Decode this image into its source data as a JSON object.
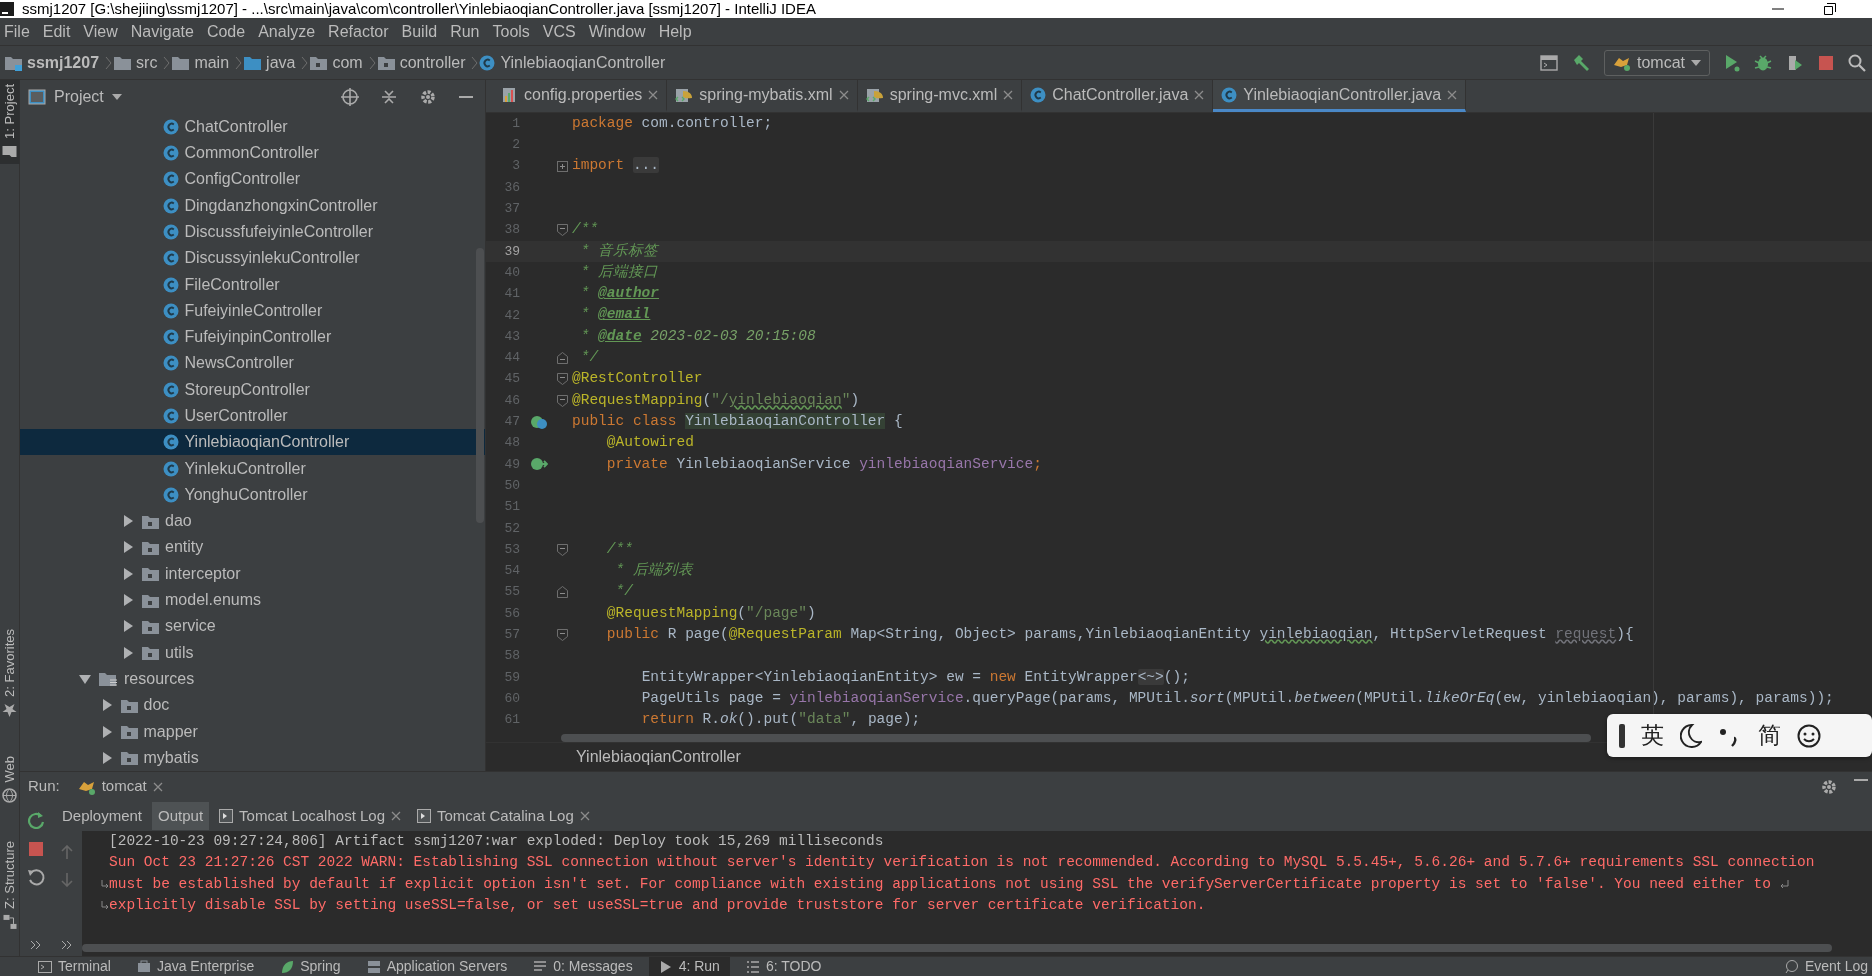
{
  "window": {
    "title": "ssmj1207 [G:\\shejiing\\ssmj1207] - ...\\src\\main\\java\\com\\controller\\YinlebiaoqianController.java [ssmj1207] - IntelliJ IDEA"
  },
  "menu": [
    "File",
    "Edit",
    "View",
    "Navigate",
    "Code",
    "Analyze",
    "Refactor",
    "Build",
    "Run",
    "Tools",
    "VCS",
    "Window",
    "Help"
  ],
  "breadcrumb": [
    {
      "label": "ssmj1207",
      "kind": "module"
    },
    {
      "label": "src",
      "kind": "folder"
    },
    {
      "label": "main",
      "kind": "folder"
    },
    {
      "label": "java",
      "kind": "source"
    },
    {
      "label": "com",
      "kind": "package"
    },
    {
      "label": "controller",
      "kind": "package"
    },
    {
      "label": "YinlebiaoqianController",
      "kind": "class"
    }
  ],
  "run_config": {
    "label": "tomcat"
  },
  "side_tabs": [
    {
      "label": "1: Project",
      "kind": "project",
      "selected": true
    },
    {
      "label": "2: Favorites",
      "kind": "favorites",
      "selected": false
    },
    {
      "label": "Web",
      "kind": "web",
      "selected": false
    },
    {
      "label": "Z: Structure",
      "kind": "structure",
      "selected": false
    }
  ],
  "project": {
    "title": "Project",
    "tree": [
      {
        "children": [
          {
            "children": [
              {
                "children": [
                  {
                    "label": "ChatController",
                    "kind": "class",
                    "selected": false
                  },
                  {
                    "label": "CommonController",
                    "kind": "class",
                    "selected": false
                  },
                  {
                    "label": "ConfigController",
                    "kind": "class",
                    "selected": false
                  },
                  {
                    "label": "DingdanzhongxinController",
                    "kind": "class",
                    "selected": false
                  },
                  {
                    "label": "DiscussfufeiyinleController",
                    "kind": "class",
                    "selected": false
                  },
                  {
                    "label": "DiscussyinlekuController",
                    "kind": "class",
                    "selected": false
                  },
                  {
                    "label": "FileController",
                    "kind": "class",
                    "selected": false
                  },
                  {
                    "label": "FufeiyinleController",
                    "kind": "class",
                    "selected": false
                  },
                  {
                    "label": "FufeiyinpinController",
                    "kind": "class",
                    "selected": false
                  },
                  {
                    "label": "NewsController",
                    "kind": "class",
                    "selected": false
                  },
                  {
                    "label": "StoreupController",
                    "kind": "class",
                    "selected": false
                  },
                  {
                    "label": "UserController",
                    "kind": "class",
                    "selected": false
                  },
                  {
                    "label": "YinlebiaoqianController",
                    "kind": "class",
                    "selected": true
                  },
                  {
                    "label": "YinlekuController",
                    "kind": "class",
                    "selected": false
                  },
                  {
                    "label": "YonghuController",
                    "kind": "class",
                    "selected": false
                  }
                ]
              },
              {
                "label": "dao",
                "kind": "package",
                "selected": false,
                "expanded": false
              },
              {
                "label": "entity",
                "kind": "package",
                "selected": false,
                "expanded": false
              },
              {
                "label": "interceptor",
                "kind": "package",
                "selected": false,
                "expanded": false
              },
              {
                "label": "model.enums",
                "kind": "package",
                "selected": false,
                "expanded": false
              },
              {
                "label": "service",
                "kind": "package",
                "selected": false,
                "expanded": false
              },
              {
                "label": "utils",
                "kind": "package",
                "selected": false,
                "expanded": false
              }
            ]
          }
        ]
      },
      {
        "label": "resources",
        "kind": "resources",
        "selected": false,
        "expanded": true,
        "children": [
          {
            "label": "doc",
            "kind": "package",
            "selected": false,
            "expanded": false
          },
          {
            "label": "mapper",
            "kind": "package",
            "selected": false,
            "expanded": false
          },
          {
            "label": "mybatis",
            "kind": "package",
            "selected": false,
            "expanded": false
          }
        ]
      }
    ]
  },
  "editor": {
    "tabs": [
      {
        "label": "config.properties",
        "kind": "properties",
        "selected": false
      },
      {
        "label": "spring-mybatis.xml",
        "kind": "xml",
        "selected": false
      },
      {
        "label": "spring-mvc.xml",
        "kind": "xml",
        "selected": false
      },
      {
        "label": "ChatController.java",
        "kind": "class",
        "selected": false
      },
      {
        "label": "YinlebiaoqianController.java",
        "kind": "class",
        "selected": true
      }
    ],
    "lines": [
      {
        "number": "1",
        "current": false,
        "tokens": [
          {
            "kind": "keyword",
            "text": "package"
          },
          {
            "kind": "plain",
            "text": " com.controller;"
          }
        ]
      },
      {
        "number": "2",
        "current": false
      },
      {
        "number": "3",
        "current": false,
        "gutter": {
          "kind": "fold-collapsed"
        },
        "tokens": [
          {
            "kind": "keyword",
            "text": "import "
          },
          {
            "kind": "folded",
            "text": "..."
          }
        ]
      },
      {
        "number": "36",
        "current": false
      },
      {
        "number": "37",
        "current": false
      },
      {
        "number": "38",
        "current": false,
        "gutter": {
          "kind": "fold-start"
        },
        "tokens": [
          {
            "kind": "doc",
            "text": "/**"
          }
        ]
      },
      {
        "number": "39",
        "current": true,
        "tokens": [
          {
            "kind": "doc",
            "text": " * 音乐标签"
          }
        ]
      },
      {
        "number": "40",
        "current": false,
        "tokens": [
          {
            "kind": "doc",
            "text": " * 后端接口"
          }
        ]
      },
      {
        "number": "41",
        "current": false,
        "tokens": [
          {
            "kind": "doc",
            "text": " * "
          },
          {
            "kind": "doctag",
            "text": "@author"
          }
        ]
      },
      {
        "number": "42",
        "current": false,
        "tokens": [
          {
            "kind": "doc",
            "text": " * "
          },
          {
            "kind": "doctag",
            "text": "@email"
          }
        ]
      },
      {
        "number": "43",
        "current": false,
        "tokens": [
          {
            "kind": "doc",
            "text": " * "
          },
          {
            "kind": "doctag",
            "text": "@date"
          },
          {
            "kind": "docvalue",
            "text": " 2023-02-03 20:15:08"
          }
        ]
      },
      {
        "number": "44",
        "current": false,
        "gutter": {
          "kind": "fold-end"
        },
        "tokens": [
          {
            "kind": "doc",
            "text": " */"
          }
        ]
      },
      {
        "number": "45",
        "current": false,
        "gutter": {
          "kind": "fold-start"
        },
        "tokens": [
          {
            "kind": "annotation",
            "text": "@RestController"
          }
        ]
      },
      {
        "number": "46",
        "current": false,
        "gutter": {
          "kind": "fold-start"
        },
        "tokens": [
          {
            "kind": "annotation",
            "text": "@RequestMapping"
          },
          {
            "kind": "plain",
            "text": "("
          },
          {
            "kind": "string",
            "text": "\"/"
          },
          {
            "kind": "string-typo",
            "text": "yinlebiaoqian"
          },
          {
            "kind": "string",
            "text": "\""
          },
          {
            "kind": "plain",
            "text": ")"
          }
        ]
      },
      {
        "number": "47",
        "current": false,
        "gutter": {
          "kind": "bean-class"
        },
        "tokens": [
          {
            "kind": "keyword",
            "text": "public class "
          },
          {
            "kind": "declaration",
            "text": "YinlebiaoqianController"
          },
          {
            "kind": "plain",
            "text": " {"
          }
        ]
      },
      {
        "number": "48",
        "current": false,
        "tokens": [
          {
            "kind": "annotation",
            "text": "    @Autowired"
          }
        ]
      },
      {
        "number": "49",
        "current": false,
        "gutter": {
          "kind": "autowired"
        },
        "tokens": [
          {
            "kind": "keyword",
            "text": "    private "
          },
          {
            "kind": "plain",
            "text": "YinlebiaoqianService "
          },
          {
            "kind": "field",
            "text": "yinlebiaoqianService"
          },
          {
            "kind": "keyword",
            "text": ";"
          }
        ]
      },
      {
        "number": "50",
        "current": false
      },
      {
        "number": "51",
        "current": false
      },
      {
        "number": "52",
        "current": false
      },
      {
        "number": "53",
        "current": false,
        "gutter": {
          "kind": "fold-start"
        },
        "tokens": [
          {
            "kind": "doc",
            "text": "    /**"
          }
        ]
      },
      {
        "number": "54",
        "current": false,
        "tokens": [
          {
            "kind": "doc",
            "text": "     * 后端列表"
          }
        ]
      },
      {
        "number": "55",
        "current": false,
        "gutter": {
          "kind": "fold-end"
        },
        "tokens": [
          {
            "kind": "doc",
            "text": "     */"
          }
        ]
      },
      {
        "number": "56",
        "current": false,
        "tokens": [
          {
            "kind": "annotation",
            "text": "    @RequestMapping"
          },
          {
            "kind": "plain",
            "text": "("
          },
          {
            "kind": "string",
            "text": "\"/page\""
          },
          {
            "kind": "plain",
            "text": ")"
          }
        ]
      },
      {
        "number": "57",
        "current": false,
        "gutter": {
          "kind": "fold-start"
        },
        "tokens": [
          {
            "kind": "keyword",
            "text": "    public "
          },
          {
            "kind": "plain",
            "text": "R page("
          },
          {
            "kind": "annotation",
            "text": "@RequestParam"
          },
          {
            "kind": "plain",
            "text": " Map<String, Object> params,YinlebiaoqianEntity "
          },
          {
            "kind": "typo",
            "text": "yinlebiaoqian"
          },
          {
            "kind": "plain",
            "text": ", HttpServletRequest "
          },
          {
            "kind": "unused",
            "text": "request"
          },
          {
            "kind": "plain",
            "text": "){"
          }
        ]
      },
      {
        "number": "58",
        "current": false
      },
      {
        "number": "59",
        "current": false,
        "tokens": [
          {
            "kind": "plain",
            "text": "        EntityWrapper<YinlebiaoqianEntity> ew = "
          },
          {
            "kind": "keyword",
            "text": "new "
          },
          {
            "kind": "plain",
            "text": "EntityWrapper"
          },
          {
            "kind": "folded",
            "text": "<~>"
          },
          {
            "kind": "plain",
            "text": "();"
          }
        ]
      },
      {
        "number": "60",
        "current": false,
        "tokens": [
          {
            "kind": "plain",
            "text": "        PageUtils page = "
          },
          {
            "kind": "field",
            "text": "yinlebiaoqianService"
          },
          {
            "kind": "plain",
            "text": ".queryPage(params, MPUtil."
          },
          {
            "kind": "static",
            "text": "sort"
          },
          {
            "kind": "plain",
            "text": "(MPUtil."
          },
          {
            "kind": "static",
            "text": "between"
          },
          {
            "kind": "plain",
            "text": "(MPUtil."
          },
          {
            "kind": "static",
            "text": "likeOrEq"
          },
          {
            "kind": "plain",
            "text": "(ew, yinlebiaoqian), params), params));"
          }
        ]
      },
      {
        "number": "61",
        "current": false,
        "tokens": [
          {
            "kind": "keyword",
            "text": "        return "
          },
          {
            "kind": "plain",
            "text": "R."
          },
          {
            "kind": "static",
            "text": "ok"
          },
          {
            "kind": "plain",
            "text": "().put("
          },
          {
            "kind": "string",
            "text": "\"data\""
          },
          {
            "kind": "plain",
            "text": ", page);"
          }
        ]
      }
    ],
    "breadcrumb": "YinlebiaoqianController"
  },
  "ime": [
    {
      "kind": "handle"
    },
    {
      "kind": "text",
      "label": "英"
    },
    {
      "kind": "moon"
    },
    {
      "kind": "punctuation"
    },
    {
      "kind": "text",
      "label": "简"
    },
    {
      "kind": "smiley"
    }
  ],
  "run": {
    "title": "Run:",
    "config": "tomcat",
    "tabs": [
      {
        "label": "Deployment",
        "selected": false,
        "closable": false
      },
      {
        "label": "Output",
        "selected": true,
        "closable": false
      },
      {
        "label": "Tomcat Localhost Log",
        "selected": false,
        "closable": true
      },
      {
        "label": "Tomcat Catalina Log",
        "selected": false,
        "closable": true
      }
    ],
    "console": [
      {
        "kind": "info",
        "text": "[2022-10-23 09:27:24,806] Artifact ssmj1207:war exploded: Deploy took 15,269 milliseconds"
      },
      {
        "kind": "error",
        "text": "Sun Oct 23 21:27:26 CST 2022 WARN: Establishing SSL connection without server's identity verification is not recommended. According to MySQL 5.5.45+, 5.6.26+ and 5.7.6+ requirements SSL connection"
      },
      {
        "kind": "error",
        "wrapped_from_previous": true,
        "wraps_to_next": true,
        "text": "must be established by default if explicit option isn't set. For compliance with existing applications not using SSL the verifyServerCertificate property is set to 'false'. You need either to"
      },
      {
        "kind": "error",
        "wrapped_from_previous": true,
        "text": "explicitly disable SSL by setting useSSL=false, or set useSSL=true and provide truststore for server certificate verification."
      }
    ]
  },
  "status_bar": {
    "tools": [
      {
        "label": "Terminal",
        "kind": "terminal",
        "selected": false
      },
      {
        "label": "Java Enterprise",
        "kind": "enterprise",
        "selected": false
      },
      {
        "label": "Spring",
        "kind": "spring",
        "selected": false
      },
      {
        "label": "Application Servers",
        "kind": "servers",
        "selected": false
      },
      {
        "label": "0: Messages",
        "kind": "messages",
        "selected": false
      },
      {
        "label": "4: Run",
        "kind": "run",
        "selected": true
      },
      {
        "label": "6: TODO",
        "kind": "todo",
        "selected": false
      }
    ],
    "event_log": "Event Log"
  }
}
